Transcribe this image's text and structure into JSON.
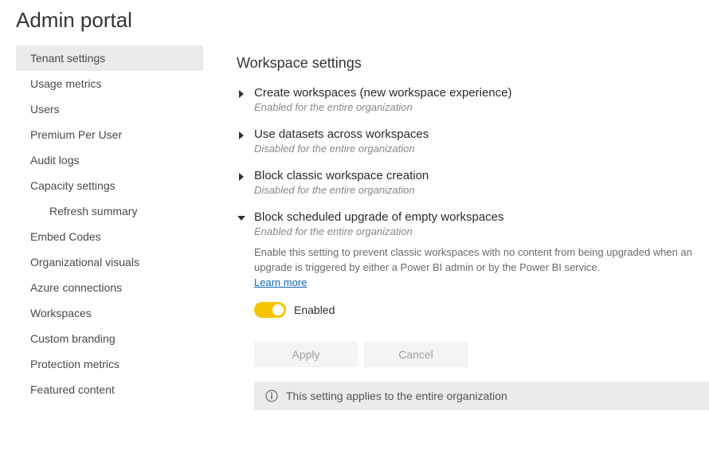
{
  "page": {
    "title": "Admin portal"
  },
  "sidebar": {
    "items": [
      {
        "label": "Tenant settings",
        "selected": true,
        "child": false
      },
      {
        "label": "Usage metrics",
        "selected": false,
        "child": false
      },
      {
        "label": "Users",
        "selected": false,
        "child": false
      },
      {
        "label": "Premium Per User",
        "selected": false,
        "child": false
      },
      {
        "label": "Audit logs",
        "selected": false,
        "child": false
      },
      {
        "label": "Capacity settings",
        "selected": false,
        "child": false
      },
      {
        "label": "Refresh summary",
        "selected": false,
        "child": true
      },
      {
        "label": "Embed Codes",
        "selected": false,
        "child": false
      },
      {
        "label": "Organizational visuals",
        "selected": false,
        "child": false
      },
      {
        "label": "Azure connections",
        "selected": false,
        "child": false
      },
      {
        "label": "Workspaces",
        "selected": false,
        "child": false
      },
      {
        "label": "Custom branding",
        "selected": false,
        "child": false
      },
      {
        "label": "Protection metrics",
        "selected": false,
        "child": false
      },
      {
        "label": "Featured content",
        "selected": false,
        "child": false
      }
    ]
  },
  "section": {
    "heading": "Workspace settings"
  },
  "settings": [
    {
      "title": "Create workspaces (new workspace experience)",
      "status": "Enabled for the entire organization",
      "expanded": false
    },
    {
      "title": "Use datasets across workspaces",
      "status": "Disabled for the entire organization",
      "expanded": false
    },
    {
      "title": "Block classic workspace creation",
      "status": "Disabled for the entire organization",
      "expanded": false
    },
    {
      "title": "Block scheduled upgrade of empty workspaces",
      "status": "Enabled for the entire organization",
      "expanded": true,
      "description": "Enable this setting to prevent classic workspaces with no content from being upgraded when an upgrade is triggered by either a Power BI admin or by the Power BI service.",
      "learn_more": "Learn more",
      "toggle_label": "Enabled"
    }
  ],
  "actions": {
    "apply": "Apply",
    "cancel": "Cancel"
  },
  "notice": {
    "text": "This setting applies to the entire organization"
  }
}
